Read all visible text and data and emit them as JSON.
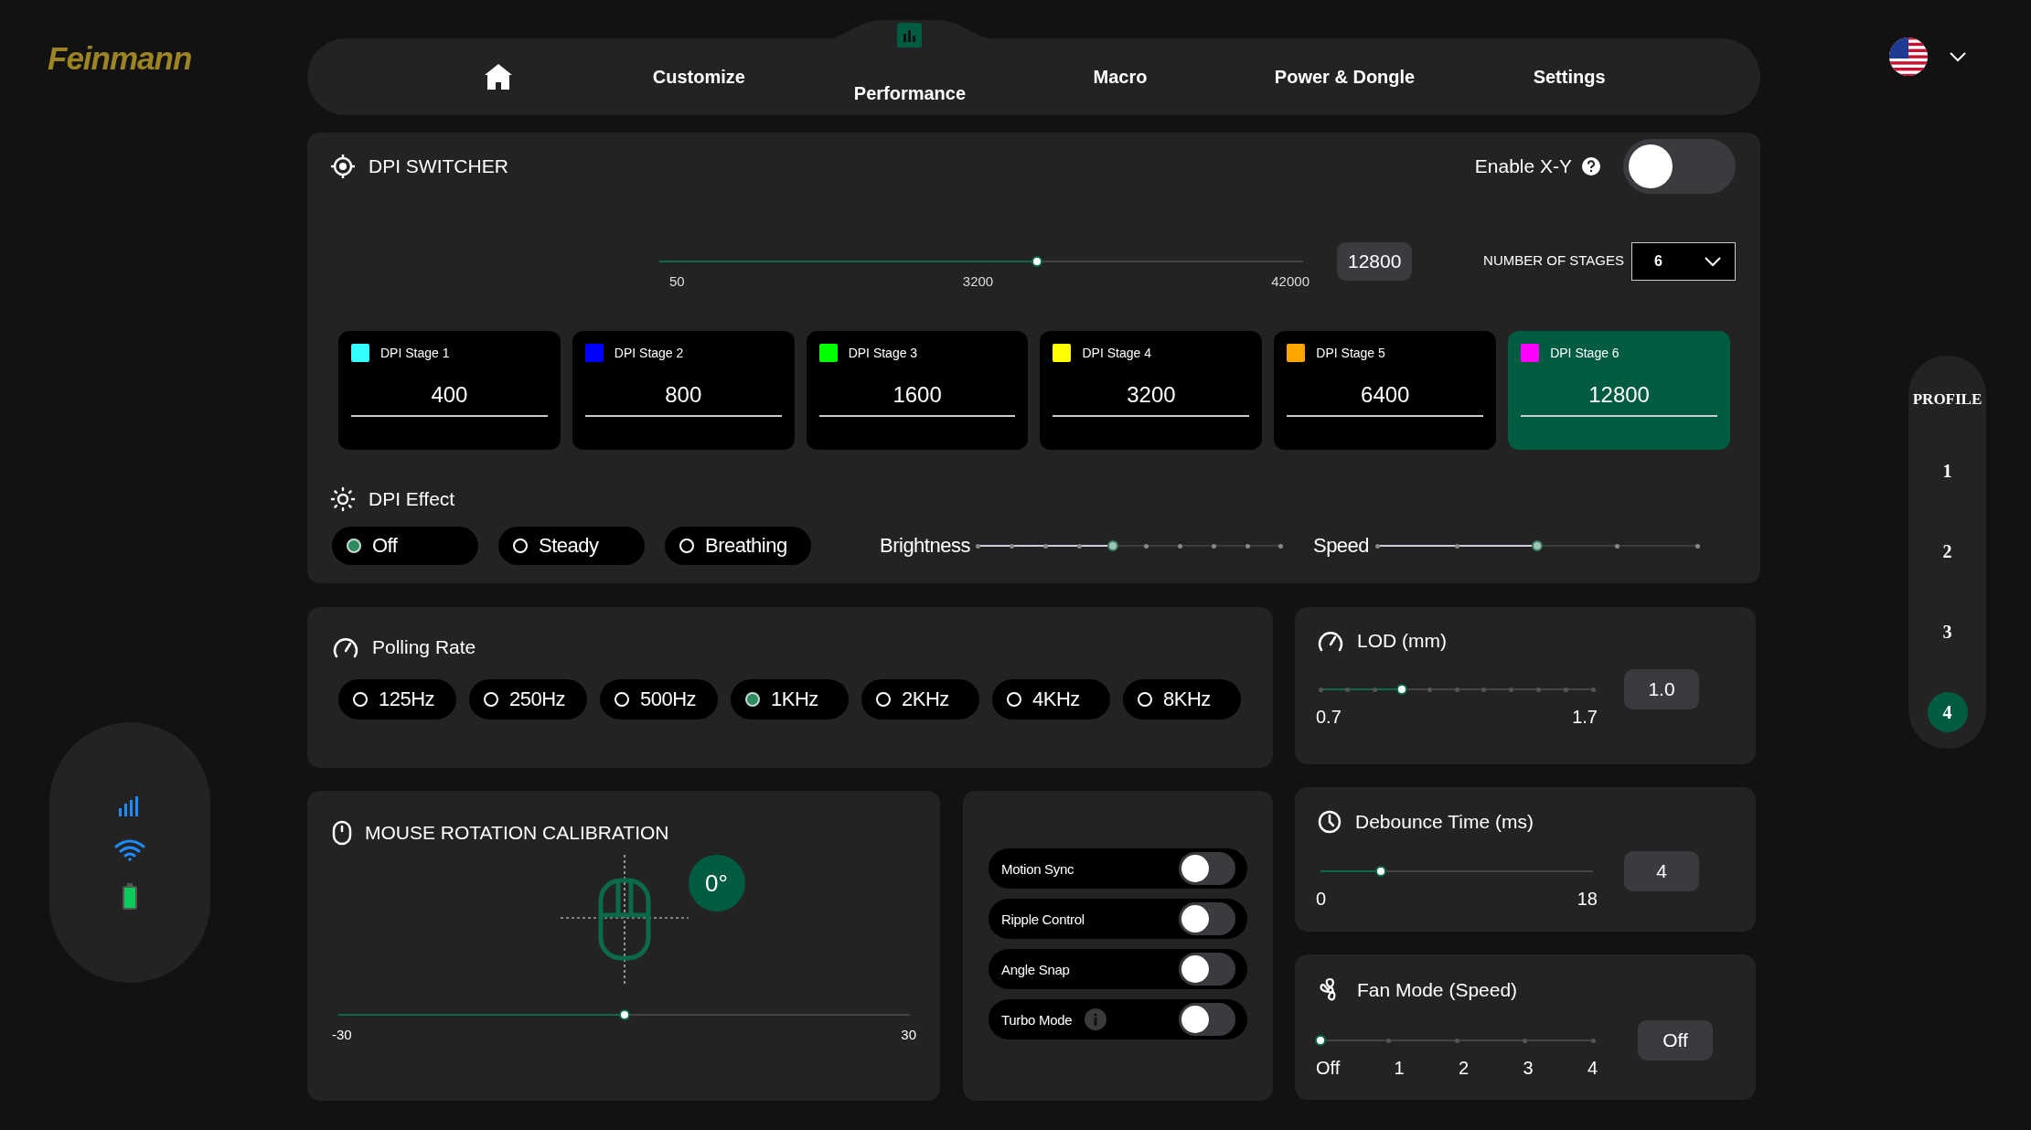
{
  "brand": "Feinmann",
  "nav": {
    "tabs": [
      {
        "kind": "home",
        "selected": false
      },
      {
        "kind": "text",
        "label": "Customize",
        "selected": false
      },
      {
        "kind": "text",
        "label": "Performance",
        "selected": true
      },
      {
        "kind": "text",
        "label": "Macro",
        "selected": false
      },
      {
        "kind": "text",
        "label": "Power & Dongle",
        "selected": false
      },
      {
        "kind": "text",
        "label": "Settings",
        "selected": false
      }
    ]
  },
  "dpi_switcher": {
    "title": "DPI SWITCHER",
    "enable_xy": {
      "label": "Enable X-Y",
      "on": false
    },
    "slider": {
      "level": 0.587,
      "labels": [
        "50",
        "3200",
        "42000"
      ],
      "value": "12800"
    },
    "stages_label": "NUMBER OF STAGES",
    "stages_value": "6",
    "stages": [
      {
        "label": "DPI Stage 1",
        "value": "400",
        "color": "#33ffff",
        "selected": false
      },
      {
        "label": "DPI Stage 2",
        "value": "800",
        "color": "#0000ff",
        "selected": false
      },
      {
        "label": "DPI Stage 3",
        "value": "1600",
        "color": "#00ff00",
        "selected": false
      },
      {
        "label": "DPI Stage 4",
        "value": "3200",
        "color": "#ffff00",
        "selected": false
      },
      {
        "label": "DPI Stage 5",
        "value": "6400",
        "color": "#ffa500",
        "selected": false
      },
      {
        "label": "DPI Stage 6",
        "value": "12800",
        "color": "#ff00ff",
        "selected": true
      }
    ]
  },
  "dpi_effect": {
    "title": "DPI Effect",
    "modes": [
      {
        "label": "Off",
        "selected": true
      },
      {
        "label": "Steady",
        "selected": false
      },
      {
        "label": "Breathing",
        "selected": false
      }
    ],
    "brightness": {
      "label": "Brightness",
      "level": 0.444
    },
    "speed": {
      "label": "Speed",
      "level": 0.5
    }
  },
  "polling_rate": {
    "title": "Polling Rate",
    "options": [
      {
        "label": "125Hz",
        "selected": false
      },
      {
        "label": "250Hz",
        "selected": false
      },
      {
        "label": "500Hz",
        "selected": false
      },
      {
        "label": "1KHz",
        "selected": true
      },
      {
        "label": "2KHz",
        "selected": false
      },
      {
        "label": "4KHz",
        "selected": false
      },
      {
        "label": "8KHz",
        "selected": false
      }
    ]
  },
  "lod": {
    "title": "LOD (mm)",
    "level": 0.3,
    "labels": [
      "0.7",
      "1.7"
    ],
    "value": "1.0"
  },
  "rotation": {
    "title": "MOUSE ROTATION CALIBRATION",
    "angle": "0°",
    "level": 0.5,
    "labels": [
      "-30",
      "30"
    ]
  },
  "switches": [
    {
      "label": "Motion Sync",
      "on": false,
      "info": false
    },
    {
      "label": "Ripple Control",
      "on": false,
      "info": false
    },
    {
      "label": "Angle Snap",
      "on": false,
      "info": false
    },
    {
      "label": "Turbo Mode",
      "on": false,
      "info": true
    }
  ],
  "debounce": {
    "title": "Debounce Time (ms)",
    "level": 0.22,
    "labels": [
      "0",
      "18"
    ],
    "value": "4"
  },
  "fan": {
    "title": "Fan Mode (Speed)",
    "level": 0,
    "labels": [
      "Off",
      "1",
      "2",
      "3",
      "4"
    ],
    "value": "Off"
  },
  "profile": {
    "title": "PROFILE",
    "items": [
      {
        "label": "1",
        "selected": false
      },
      {
        "label": "2",
        "selected": false
      },
      {
        "label": "3",
        "selected": false
      },
      {
        "label": "4",
        "selected": true
      }
    ]
  }
}
